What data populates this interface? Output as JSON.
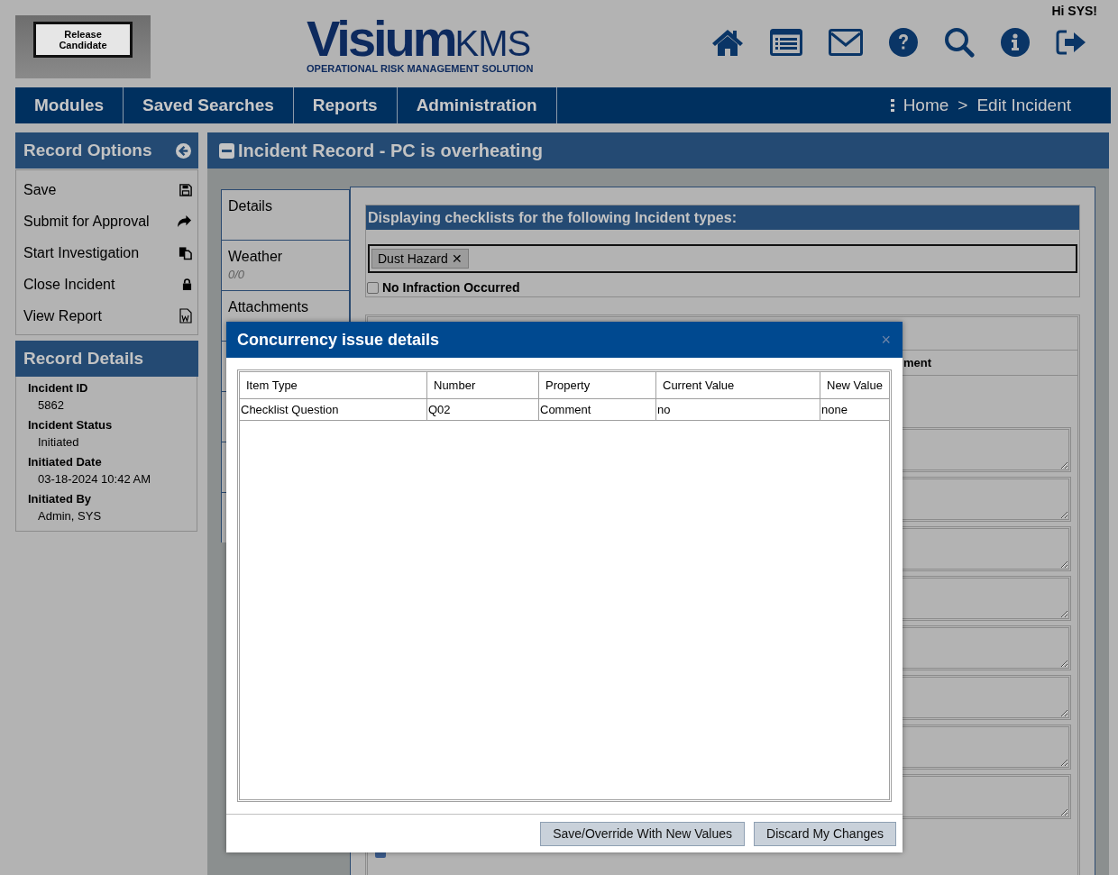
{
  "header": {
    "banner": "Release Candidate",
    "logo": {
      "name": "Visium",
      "suffix": "KMS",
      "tagline": "OPERATIONAL RISK MANAGEMENT SOLUTION"
    },
    "greeting": "Hi SYS!"
  },
  "nav": {
    "menu": [
      "Modules",
      "Saved Searches",
      "Reports",
      "Administration"
    ],
    "breadcrumb": [
      "Home",
      "Edit Incident"
    ],
    "separator": ">"
  },
  "record_options": {
    "title": "Record Options",
    "items": [
      {
        "label": "Save",
        "kind": "save"
      },
      {
        "label": "Submit for Approval",
        "kind": "submit"
      },
      {
        "label": "Start Investigation",
        "kind": "investigate"
      },
      {
        "label": "Close Incident",
        "kind": "lock"
      },
      {
        "label": "View Report",
        "kind": "report"
      }
    ]
  },
  "record_details": {
    "title": "Record Details",
    "fields": [
      {
        "label": "Incident ID",
        "value": "5862"
      },
      {
        "label": "Incident Status",
        "value": "Initiated"
      },
      {
        "label": "Initiated Date",
        "value": "03-18-2024 10:42 AM"
      },
      {
        "label": "Initiated By",
        "value": "Admin, SYS"
      }
    ]
  },
  "record": {
    "title": "Incident Record - PC is overheating",
    "tabs": [
      {
        "label": "Details"
      },
      {
        "label": "Weather",
        "count": "0/0"
      },
      {
        "label": "Attachments"
      }
    ]
  },
  "checklists": {
    "heading": "Displaying checklists for the following Incident types:",
    "types": [
      {
        "label": "Dust Hazard",
        "remove": "✕"
      }
    ],
    "no_infraction": {
      "label": "No Infraction Occurred",
      "checked": false
    }
  },
  "behind": {
    "column_text": "ment"
  },
  "dialog": {
    "title": "Concurrency issue details",
    "close": "×",
    "columns": [
      "Item Type",
      "Number",
      "Property",
      "Current Value",
      "New Value"
    ],
    "rows": [
      [
        "Checklist Question",
        "Q02",
        "Comment",
        "no",
        "none"
      ]
    ],
    "buttons": [
      "Save/Override With New Values",
      "Discard My Changes"
    ]
  }
}
